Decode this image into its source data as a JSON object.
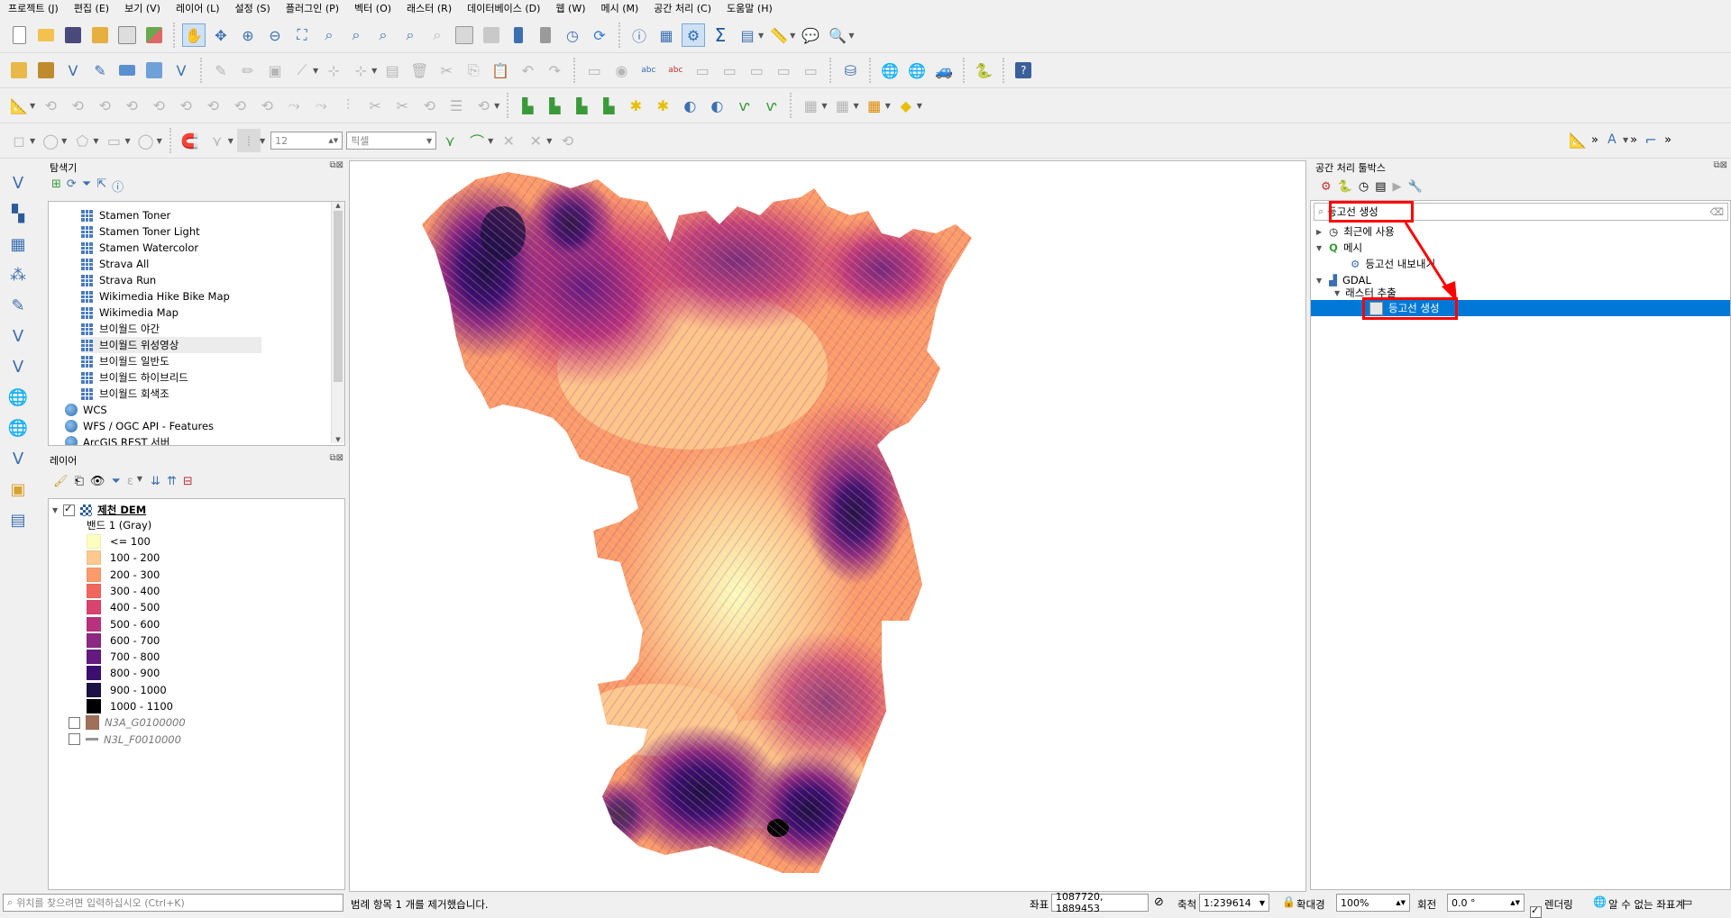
{
  "menu": [
    "프로젝트 (J)",
    "편집 (E)",
    "보기 (V)",
    "레이어 (L)",
    "설정 (S)",
    "플러그인 (P)",
    "벡터 (O)",
    "래스터 (R)",
    "데이터베이스 (D)",
    "웹 (W)",
    "메시 (M)",
    "공간 처리 (C)",
    "도움말 (H)"
  ],
  "toolbar": {
    "snap_tolerance_value": "12",
    "snap_units": "픽셀"
  },
  "browser_panel": {
    "title": "탐색기",
    "items": [
      {
        "label": "Stamen Toner",
        "icon": "tile-grid-icon"
      },
      {
        "label": "Stamen Toner Light",
        "icon": "tile-grid-icon"
      },
      {
        "label": "Stamen Watercolor",
        "icon": "tile-grid-icon"
      },
      {
        "label": "Strava All",
        "icon": "tile-grid-icon"
      },
      {
        "label": "Strava Run",
        "icon": "tile-grid-icon"
      },
      {
        "label": "Wikimedia Hike Bike Map",
        "icon": "tile-grid-icon"
      },
      {
        "label": "Wikimedia Map",
        "icon": "tile-grid-icon"
      },
      {
        "label": "브이월드 야간",
        "icon": "tile-grid-icon"
      },
      {
        "label": "브이월드 위성영상",
        "icon": "tile-grid-icon"
      },
      {
        "label": "브이월드 일반도",
        "icon": "tile-grid-icon"
      },
      {
        "label": "브이월드 하이브리드",
        "icon": "tile-grid-icon"
      },
      {
        "label": "브이월드 회색조",
        "icon": "tile-grid-icon"
      }
    ],
    "root_items": [
      {
        "label": "WCS",
        "icon": "globe-icon"
      },
      {
        "label": "WFS / OGC API - Features",
        "icon": "globe-icon"
      },
      {
        "label": "ArcGIS REST 서버",
        "icon": "globe-icon"
      }
    ]
  },
  "layers_panel": {
    "title": "레이어",
    "layer_name": "제천 DEM",
    "band": "밴드 1 (Gray)",
    "legend": [
      {
        "label": "<= 100",
        "color": "#fcfdbf"
      },
      {
        "label": "100 - 200",
        "color": "#fdc98f"
      },
      {
        "label": "200 - 300",
        "color": "#fb9b6b"
      },
      {
        "label": "300 - 400",
        "color": "#f1675d"
      },
      {
        "label": "400 - 500",
        "color": "#d9436f"
      },
      {
        "label": "500 - 600",
        "color": "#b8327d"
      },
      {
        "label": "600 - 700",
        "color": "#8c2981"
      },
      {
        "label": "700 - 800",
        "color": "#641a80"
      },
      {
        "label": "800 - 900",
        "color": "#3b0f70"
      },
      {
        "label": "900 - 1000",
        "color": "#1c1044"
      },
      {
        "label": "1000 - 1100",
        "color": "#000004"
      }
    ],
    "other_layers": [
      {
        "label": "N3A_G0100000",
        "swatch": "#a0705a"
      },
      {
        "label": "N3L_F0010000",
        "swatch": "#9a9a9a"
      }
    ]
  },
  "processing_panel": {
    "title": "공간 처리 툴박스",
    "search_value": "등고선 생성",
    "tree": {
      "recent": "최근에 사용",
      "mesh": "메시",
      "mesh_child": "등고선 내보내기",
      "gdal": "GDAL",
      "raster_extract": "래스터 추출",
      "selected": "등고선 생성"
    }
  },
  "statusbar": {
    "locator_placeholder": "위치를 찾으려면 입력하십시오 (Ctrl+K)",
    "message": "범례 항목 1 개를 제거했습니다.",
    "coord_label": "좌표",
    "coord_value": "1087720, 1889453",
    "scale_label": "축척",
    "scale_value": "1:239614",
    "magnifier_label": "확대경",
    "magnifier_value": "100%",
    "rotation_label": "회전",
    "rotation_value": "0.0 °",
    "render_label": "렌더링",
    "crs_label": "알 수 없는 좌표계"
  }
}
